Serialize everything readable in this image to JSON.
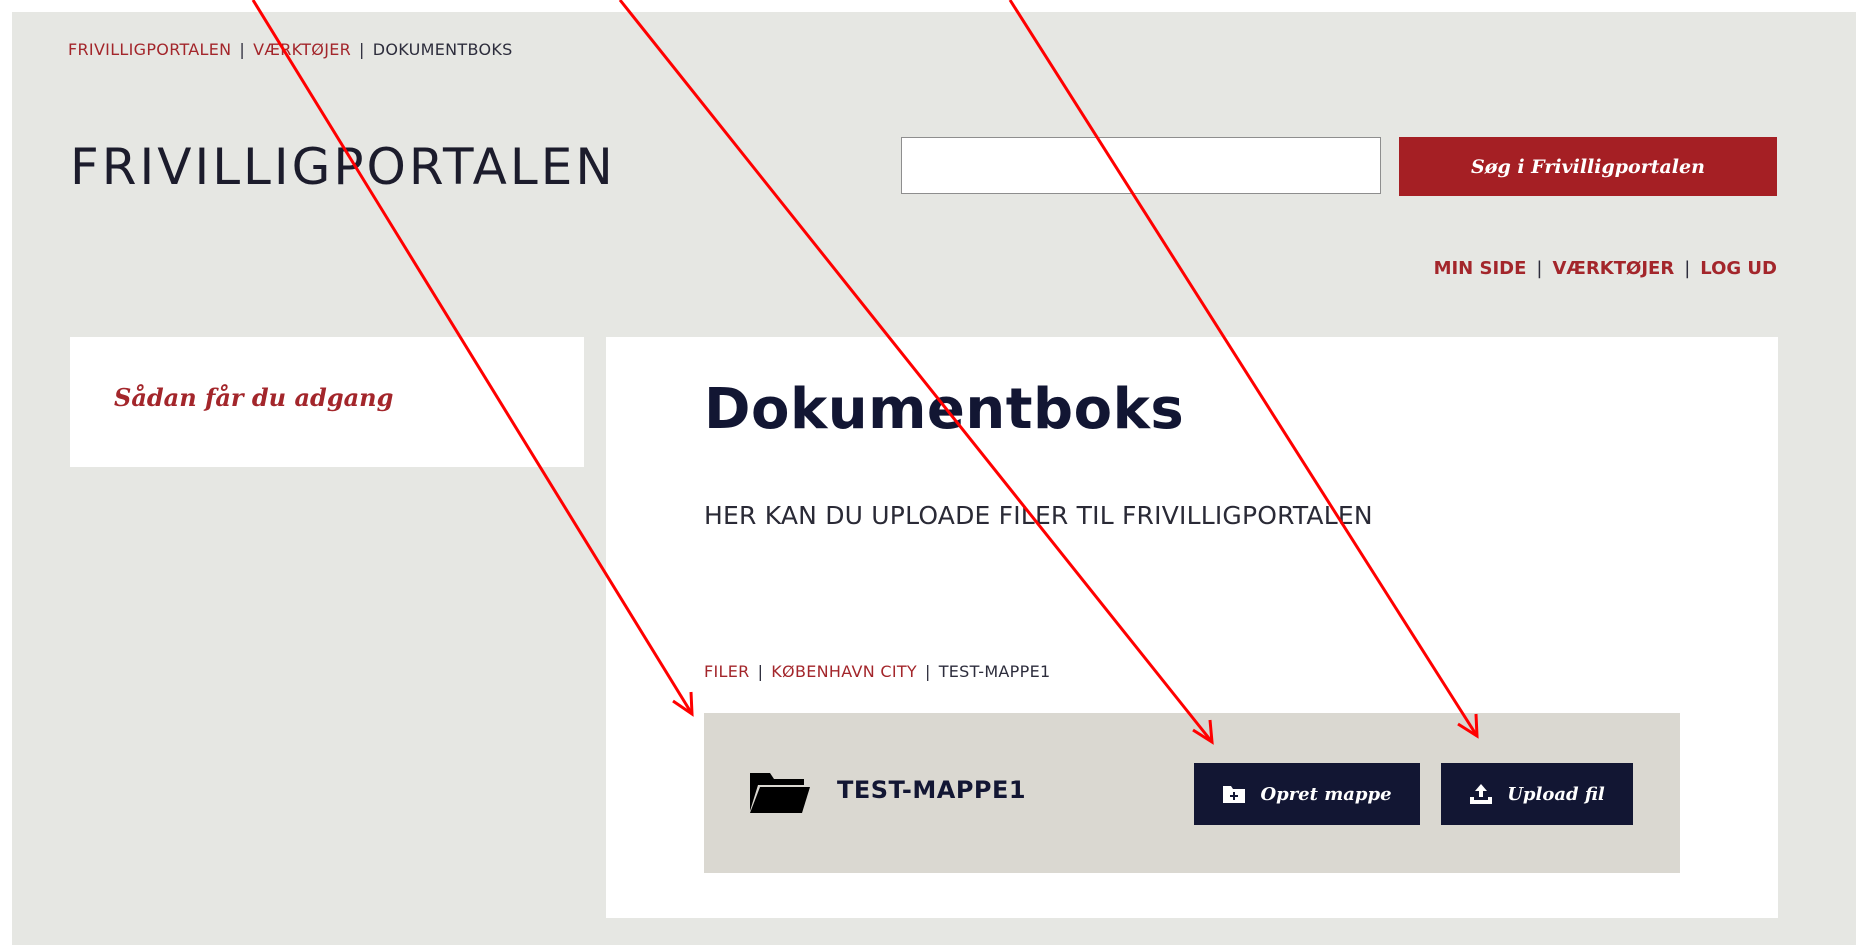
{
  "breadcrumb": {
    "items": [
      "FRIVILLIGPORTALEN",
      "VÆRKTØJER",
      "DOKUMENTBOKS"
    ],
    "separator": "|"
  },
  "header": {
    "logo": "FRIVILLIGPORTALEN",
    "search": {
      "value": "",
      "placeholder": "",
      "button_label": "Søg i Frivilligportalen"
    },
    "user_nav": [
      "MIN SIDE",
      "VÆRKTØJER",
      "LOG UD"
    ]
  },
  "sidebar": {
    "link_label": "Sådan får du adgang"
  },
  "main": {
    "title": "Dokumentboks",
    "subtitle": "HER KAN DU UPLOADE FILER TIL FRIVILLIGPORTALEN",
    "folder_breadcrumb": [
      "FILER",
      "KØBENHAVN CITY",
      "TEST-MAPPE1"
    ],
    "current_folder": "TEST-MAPPE1",
    "create_folder_label": "Opret mappe",
    "upload_label": "Upload fil"
  },
  "icons": {
    "folder": "folder-open-icon",
    "create_folder": "folder-plus-icon",
    "upload": "upload-icon"
  },
  "colors": {
    "accent_red": "#a51f24",
    "dark_navy": "#121633",
    "page_bg": "#e6e7e3",
    "folder_bar_bg": "#dad8d1",
    "annotation_arrows": "#ff0000"
  }
}
